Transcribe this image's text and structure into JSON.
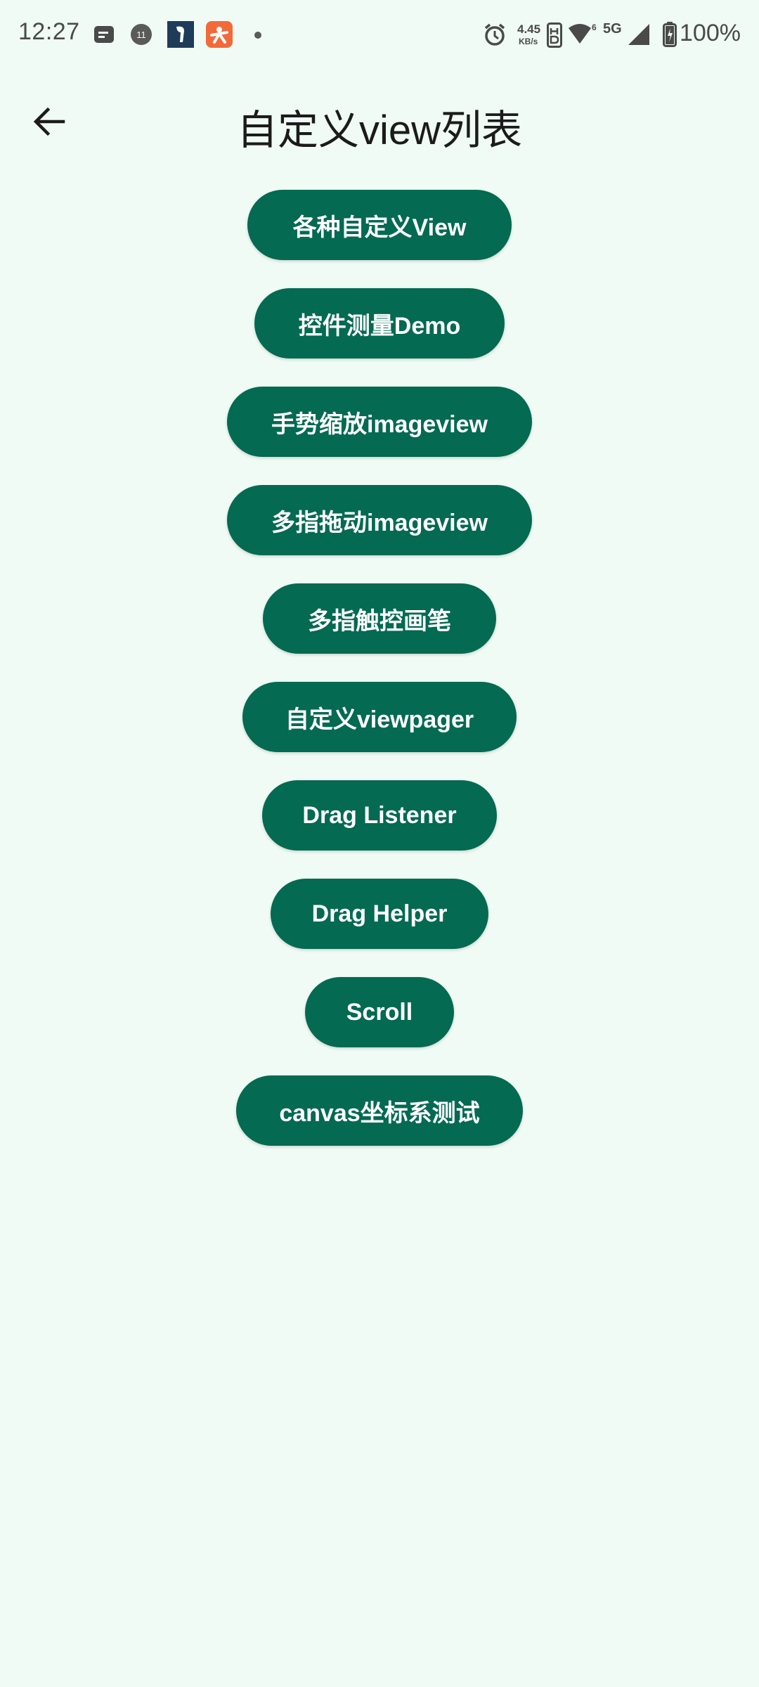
{
  "status_bar": {
    "time": "12:27",
    "notif_badge_count": "11",
    "net_speed_value": "4.45",
    "net_speed_unit": "KB/s",
    "network_type": "5G",
    "battery": "100%",
    "icons": [
      "message-icon",
      "notification-badge-icon",
      "app-icon",
      "app-icon-orange",
      "dot-icon",
      "alarm-icon",
      "hd-icon",
      "wifi-icon",
      "signal-icon",
      "battery-icon"
    ]
  },
  "app_bar": {
    "back_icon": "arrow-left-icon",
    "title": "自定义view列表"
  },
  "buttons": [
    {
      "label": "各种自定义View"
    },
    {
      "label": "控件测量Demo"
    },
    {
      "label": "手势缩放imageview"
    },
    {
      "label": "多指拖动imageview"
    },
    {
      "label": "多指触控画笔"
    },
    {
      "label": "自定义viewpager"
    },
    {
      "label": "Drag Listener"
    },
    {
      "label": "Drag Helper"
    },
    {
      "label": "Scroll"
    },
    {
      "label": "canvas坐标系测试"
    }
  ],
  "colors": {
    "background": "#effbf4",
    "button": "#046a52",
    "button_text": "#ffffff"
  }
}
